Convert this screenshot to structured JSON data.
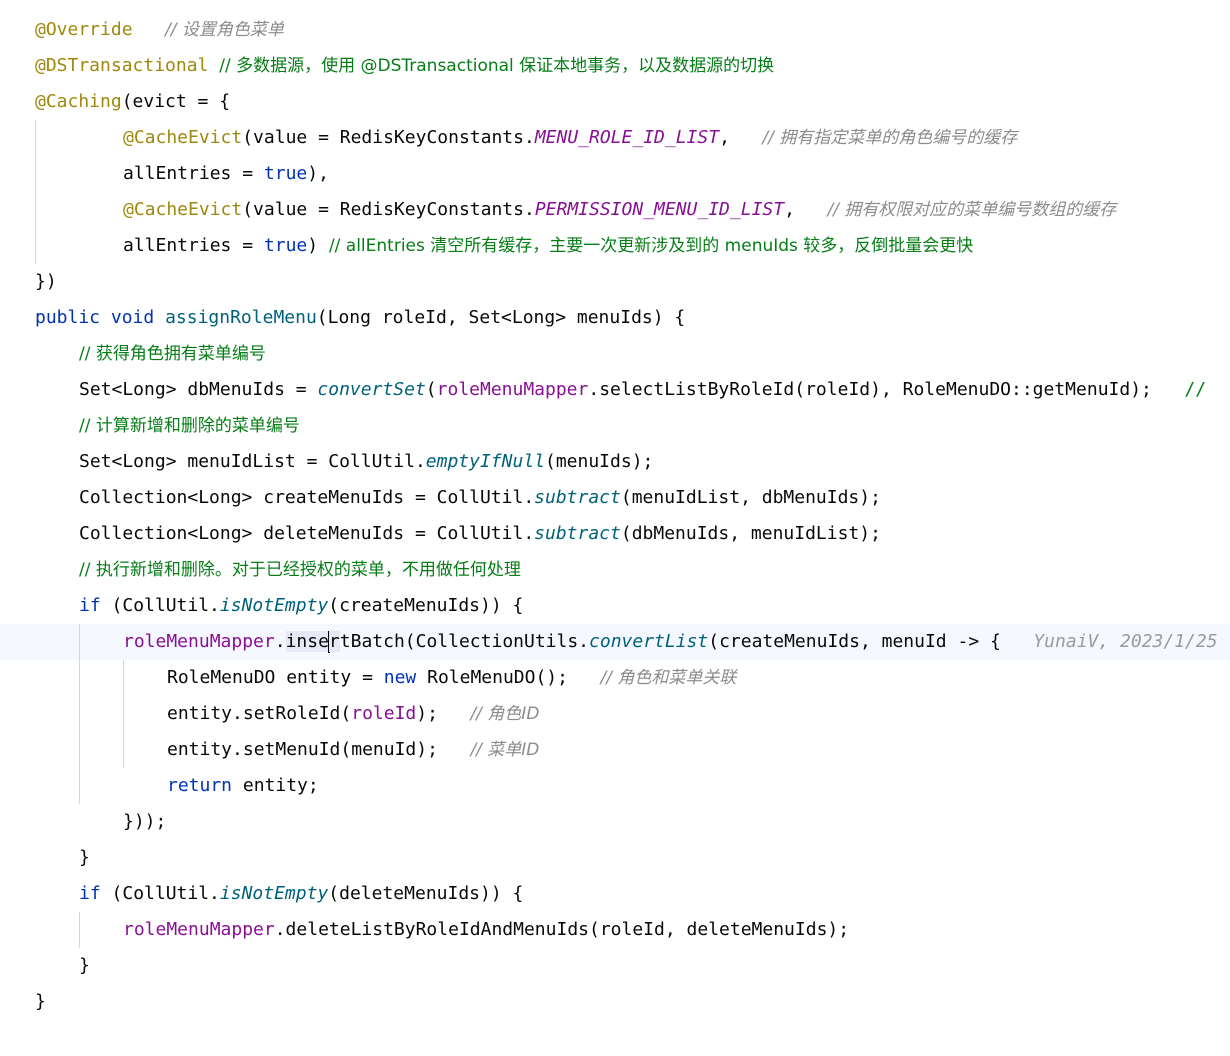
{
  "editor": {
    "hint_bulb": "lightbulb-icon",
    "lines": [
      {
        "indent": 0,
        "tokens": [
          [
            "ann",
            "@Override"
          ],
          [
            "plain",
            "   "
          ],
          [
            "cmt",
            "// 设置角色菜单"
          ]
        ]
      },
      {
        "indent": 0,
        "tokens": [
          [
            "ann",
            "@DSTransactional"
          ],
          [
            "plain",
            " "
          ],
          [
            "cmt2",
            "// 多数据源，使用 @DSTransactional 保证本地事务，以及数据源的切换"
          ]
        ]
      },
      {
        "indent": 0,
        "tokens": [
          [
            "ann",
            "@Caching"
          ],
          [
            "plain",
            "(evict = {"
          ]
        ]
      },
      {
        "indent": 2,
        "tokens": [
          [
            "ann",
            "@CacheEvict"
          ],
          [
            "plain",
            "(value = RedisKeyConstants."
          ],
          [
            "cst",
            "MENU_ROLE_ID_LIST"
          ],
          [
            "plain",
            ",   "
          ],
          [
            "cmt",
            "// 拥有指定菜单的角色编号的缓存"
          ]
        ]
      },
      {
        "indent": 2,
        "tokens": [
          [
            "plain",
            "allEntries = "
          ],
          [
            "kw",
            "true"
          ],
          [
            "plain",
            "),"
          ]
        ]
      },
      {
        "indent": 2,
        "tokens": [
          [
            "ann",
            "@CacheEvict"
          ],
          [
            "plain",
            "(value = RedisKeyConstants."
          ],
          [
            "cst",
            "PERMISSION_MENU_ID_LIST"
          ],
          [
            "plain",
            ",   "
          ],
          [
            "cmt",
            "// 拥有权限对应的菜单编号数组的缓存"
          ]
        ]
      },
      {
        "indent": 2,
        "tokens": [
          [
            "plain",
            "allEntries = "
          ],
          [
            "kw",
            "true"
          ],
          [
            "plain",
            ") "
          ],
          [
            "cmt2",
            "// allEntries 清空所有缓存，主要一次更新涉及到的 menuIds 较多，反倒批量会更快"
          ]
        ]
      },
      {
        "indent": 0,
        "tokens": [
          [
            "plain",
            "})"
          ]
        ]
      },
      {
        "indent": 0,
        "tokens": [
          [
            "kw",
            "public"
          ],
          [
            "plain",
            " "
          ],
          [
            "kw",
            "void"
          ],
          [
            "plain",
            " "
          ],
          [
            "meth",
            "assignRoleMenu"
          ],
          [
            "plain",
            "(Long roleId, Set<Long> menuIds) {"
          ]
        ]
      },
      {
        "indent": 1,
        "tokens": [
          [
            "cmt2",
            "// 获得角色拥有菜单编号"
          ]
        ]
      },
      {
        "indent": 1,
        "tokens": [
          [
            "plain",
            "Set<Long> dbMenuIds = "
          ],
          [
            "stat",
            "convertSet"
          ],
          [
            "plain",
            "("
          ],
          [
            "fld",
            "roleMenuMapper"
          ],
          [
            "plain",
            ".selectListByRoleId(roleId), RoleMenuDO::getMenuId);   "
          ],
          [
            "cmt2",
            "//"
          ]
        ]
      },
      {
        "indent": 1,
        "tokens": [
          [
            "cmt2",
            "// 计算新增和删除的菜单编号"
          ]
        ]
      },
      {
        "indent": 1,
        "tokens": [
          [
            "plain",
            "Set<Long> menuIdList = CollUtil."
          ],
          [
            "stat",
            "emptyIfNull"
          ],
          [
            "plain",
            "(menuIds);"
          ]
        ]
      },
      {
        "indent": 1,
        "tokens": [
          [
            "plain",
            "Collection<Long> createMenuIds = CollUtil."
          ],
          [
            "stat",
            "subtract"
          ],
          [
            "plain",
            "(menuIdList, dbMenuIds);"
          ]
        ]
      },
      {
        "indent": 1,
        "tokens": [
          [
            "plain",
            "Collection<Long> deleteMenuIds = CollUtil."
          ],
          [
            "stat",
            "subtract"
          ],
          [
            "plain",
            "(dbMenuIds, menuIdList);"
          ]
        ]
      },
      {
        "indent": 1,
        "tokens": [
          [
            "cmt2",
            "// 执行新增和删除。对于已经授权的菜单，不用做任何处理"
          ]
        ]
      },
      {
        "indent": 1,
        "tokens": [
          [
            "kw",
            "if"
          ],
          [
            "plain",
            " (CollUtil."
          ],
          [
            "stat",
            "isNotEmpty"
          ],
          [
            "plain",
            "(createMenuIds)) {"
          ]
        ]
      },
      {
        "indent": 2,
        "current": true,
        "tokens": [
          [
            "fld",
            "roleMenuMapper"
          ],
          [
            "plain",
            "."
          ],
          [
            "sel",
            "inse"
          ],
          [
            "caret",
            ""
          ],
          [
            "sel",
            "r"
          ],
          [
            "plain",
            "tBatch(CollectionUtils."
          ],
          [
            "stat",
            "convertList"
          ],
          [
            "plain",
            "(createMenuIds, menuId -> {   "
          ],
          [
            "hint",
            "YunaiV, 2023/1/25"
          ]
        ]
      },
      {
        "indent": 3,
        "tokens": [
          [
            "plain",
            "RoleMenuDO entity = "
          ],
          [
            "kw",
            "new"
          ],
          [
            "plain",
            " RoleMenuDO();   "
          ],
          [
            "cmt",
            "// 角色和菜单关联"
          ]
        ]
      },
      {
        "indent": 3,
        "tokens": [
          [
            "plain",
            "entity.setRoleId("
          ],
          [
            "param",
            "roleId"
          ],
          [
            "plain",
            ");   "
          ],
          [
            "cmt",
            "// 角色ID"
          ]
        ]
      },
      {
        "indent": 3,
        "tokens": [
          [
            "plain",
            "entity.setMenuId(menuId);   "
          ],
          [
            "cmt",
            "// 菜单ID"
          ]
        ]
      },
      {
        "indent": 3,
        "tokens": [
          [
            "kw",
            "return"
          ],
          [
            "plain",
            " entity;"
          ]
        ]
      },
      {
        "indent": 2,
        "tokens": [
          [
            "plain",
            "}));"
          ]
        ]
      },
      {
        "indent": 1,
        "tokens": [
          [
            "plain",
            "}"
          ]
        ]
      },
      {
        "indent": 1,
        "tokens": [
          [
            "kw",
            "if"
          ],
          [
            "plain",
            " (CollUtil."
          ],
          [
            "stat",
            "isNotEmpty"
          ],
          [
            "plain",
            "(deleteMenuIds)) {"
          ]
        ]
      },
      {
        "indent": 2,
        "tokens": [
          [
            "fld",
            "roleMenuMapper"
          ],
          [
            "plain",
            ".deleteListByRoleIdAndMenuIds(roleId, deleteMenuIds);"
          ]
        ]
      },
      {
        "indent": 1,
        "tokens": [
          [
            "plain",
            "}"
          ]
        ]
      },
      {
        "indent": 0,
        "tokens": [
          [
            "plain",
            "}"
          ]
        ]
      }
    ]
  }
}
